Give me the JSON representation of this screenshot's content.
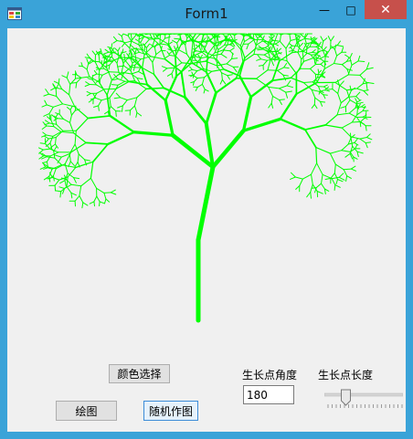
{
  "window": {
    "title": "Form1",
    "controls": {
      "minimize": "—",
      "maximize": "□",
      "close": "✕"
    }
  },
  "tree": {
    "color": "#00ff00"
  },
  "buttons": {
    "color_select": "颜色选择",
    "draw": "绘图",
    "random_draw": "随机作图"
  },
  "labels": {
    "angle": "生长点角度",
    "length": "生长点长度"
  },
  "inputs": {
    "angle_value": "180"
  },
  "slider": {
    "value": 0.25
  }
}
